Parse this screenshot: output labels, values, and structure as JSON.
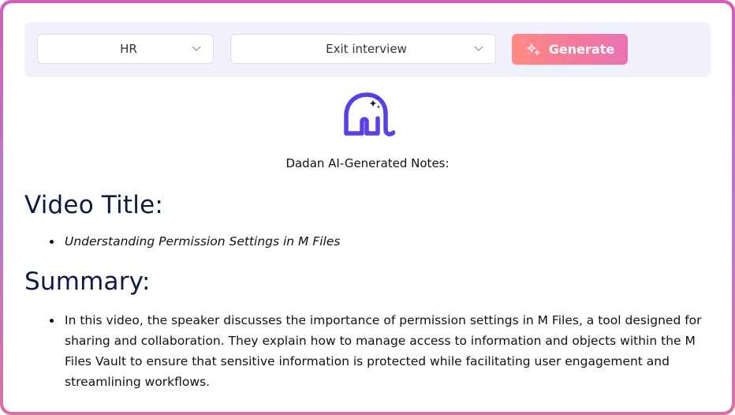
{
  "toolbar": {
    "department_select": {
      "value": "HR"
    },
    "template_select": {
      "value": "Exit interview"
    },
    "generate_label": "Generate"
  },
  "notes": {
    "caption": "Dadan AI-Generated Notes:",
    "video_title_heading": "Video Title:",
    "video_title_items": [
      "Understanding Permission Settings in M Files"
    ],
    "summary_heading": "Summary:",
    "summary_items": [
      "In this video, the speaker discusses the importance of permission settings in M Files, a tool designed for sharing and collaboration. They explain how to manage access to information and objects within the M Files Vault to ensure that sensitive information is protected while facilitating user engagement and streamlining workflows."
    ]
  },
  "icons": {
    "dropdown": "chevron-down-icon",
    "generate": "sparkle-icon",
    "logo": "elephant-logo-icon"
  },
  "colors": {
    "frame_gradient": [
      "#cf5fb6",
      "#b77ac9",
      "#d871a5"
    ],
    "toolbar_bg": "#f1f0fd",
    "button_gradient": [
      "#fe8a82",
      "#ea72b4"
    ],
    "logo": "#5b3fe0",
    "heading": "#0d1a3d"
  }
}
